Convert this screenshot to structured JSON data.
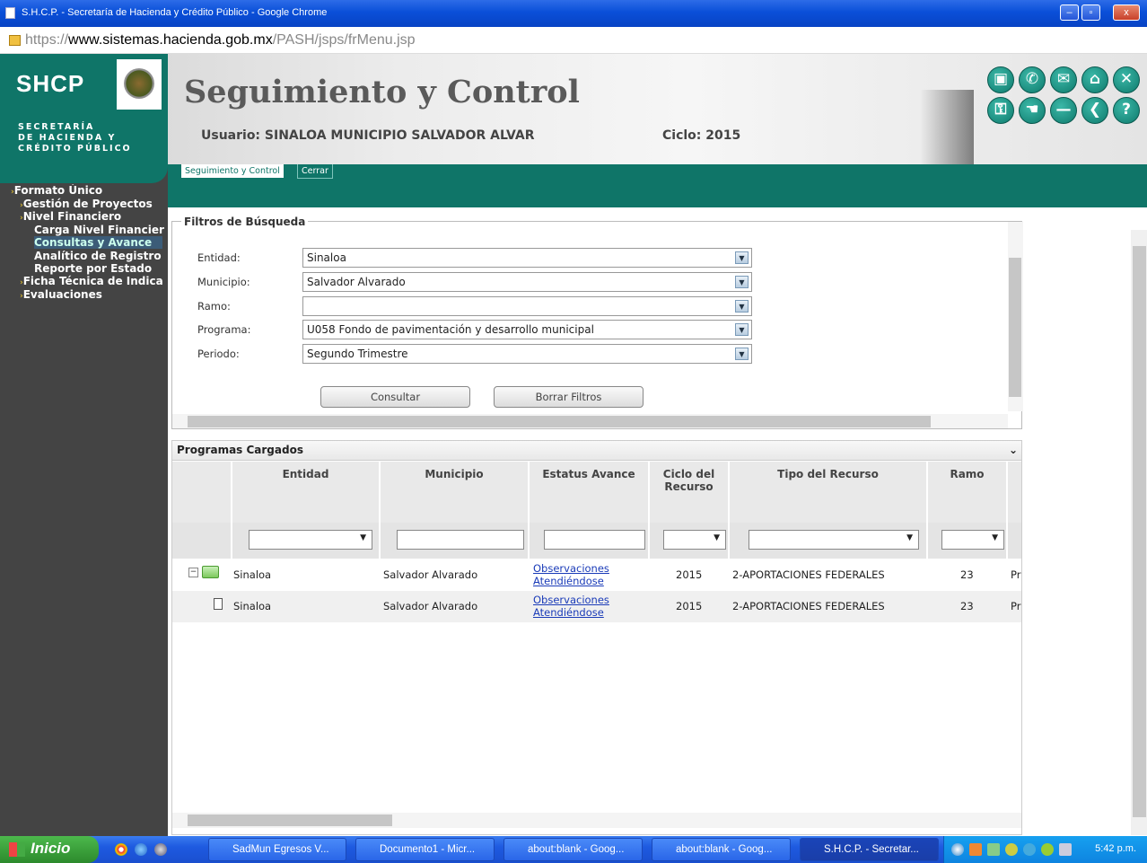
{
  "window": {
    "title": "S.H.C.P. - Secretaría de Hacienda y Crédito Público - Google Chrome",
    "min": "–",
    "max": "▫",
    "close": "x"
  },
  "browser": {
    "url_scheme": "https://",
    "url_host": "www.sistemas.hacienda.gob.mx",
    "url_path": "/PASH/jsps/frMenu.jsp"
  },
  "header": {
    "logo": "SHCP",
    "secretaria_lines": [
      "SECRETARÍA",
      "DE HACIENDA Y",
      "CRÉDITO PÚBLICO"
    ],
    "app_title": "Seguimiento y Control",
    "user_line": "Usuario: SINALOA MUNICIPIO SALVADOR ALVAR",
    "ciclo": "Ciclo: 2015",
    "icons": [
      "printer-icon",
      "phone-icon",
      "mail-icon",
      "home-icon",
      "close-icon",
      "lock-icon",
      "hand-pointer-icon",
      "minus-icon",
      "back-icon",
      "help-icon"
    ],
    "icon_glyphs": [
      "▣",
      "✆",
      "✉",
      "⌂",
      "✕",
      "⚿",
      "☚",
      "—",
      "❮",
      "?"
    ]
  },
  "tabs": [
    {
      "label": "Seguimiento y Control"
    },
    {
      "label": "Cerrar"
    }
  ],
  "nav": {
    "items": [
      {
        "label": "Formato Único",
        "level": 0,
        "arrow": "›"
      },
      {
        "label": "Gestión de Proyectos",
        "level": 1,
        "arrow": "›"
      },
      {
        "label": "Nivel Financiero",
        "level": 1,
        "arrow": "›"
      },
      {
        "label": "Carga Nivel Financiero",
        "level": 2,
        "arrow": ""
      },
      {
        "label": "Consultas y Avance",
        "level": 2,
        "arrow": "",
        "selected": true
      },
      {
        "label": "Analítico de Registro",
        "level": 2,
        "arrow": ""
      },
      {
        "label": "Reporte por Estado",
        "level": 2,
        "arrow": ""
      },
      {
        "label": "Ficha Técnica de Indicadores",
        "level": 1,
        "arrow": "›"
      },
      {
        "label": "Evaluaciones",
        "level": 1,
        "arrow": "›"
      }
    ]
  },
  "filters": {
    "legend": "Filtros de Búsqueda",
    "fields": [
      {
        "label": "Entidad:",
        "value": "Sinaloa"
      },
      {
        "label": "Municipio:",
        "value": "Salvador Alvarado"
      },
      {
        "label": "Ramo:",
        "value": ""
      },
      {
        "label": "Programa:",
        "value": "U058 Fondo de pavimentación y desarrollo municipal"
      },
      {
        "label": "Periodo:",
        "value": "Segundo Trimestre"
      }
    ],
    "consultar": "Consultar",
    "borrar": "Borrar Filtros"
  },
  "programas": {
    "title": "Programas Cargados",
    "columns": [
      "Entidad",
      "Municipio",
      "Estatus Avance",
      "Ciclo del Recurso",
      "Tipo del Recurso",
      "Ramo"
    ],
    "rows": [
      {
        "entidad": "Sinaloa",
        "municipio": "Salvador Alvarado",
        "estatus_1": "Observaciones",
        "estatus_2": "Atendiéndose",
        "ciclo": "2015",
        "tipo": "2-APORTACIONES FEDERALES",
        "ramo": "23",
        "extra": "Pr"
      },
      {
        "entidad": "Sinaloa",
        "municipio": "Salvador Alvarado",
        "estatus_1": "Observaciones",
        "estatus_2": "Atendiéndose",
        "ciclo": "2015",
        "tipo": "2-APORTACIONES FEDERALES",
        "ramo": "23",
        "extra": "Pr"
      }
    ]
  },
  "taskbar": {
    "start": "Inicio",
    "items": [
      {
        "label": "SadMun Egresos V..."
      },
      {
        "label": "Documento1 - Micr..."
      },
      {
        "label": "about:blank - Goog..."
      },
      {
        "label": "about:blank - Goog..."
      },
      {
        "label": "S.H.C.P. - Secretar..."
      }
    ],
    "clock": "5:42 p.m."
  }
}
